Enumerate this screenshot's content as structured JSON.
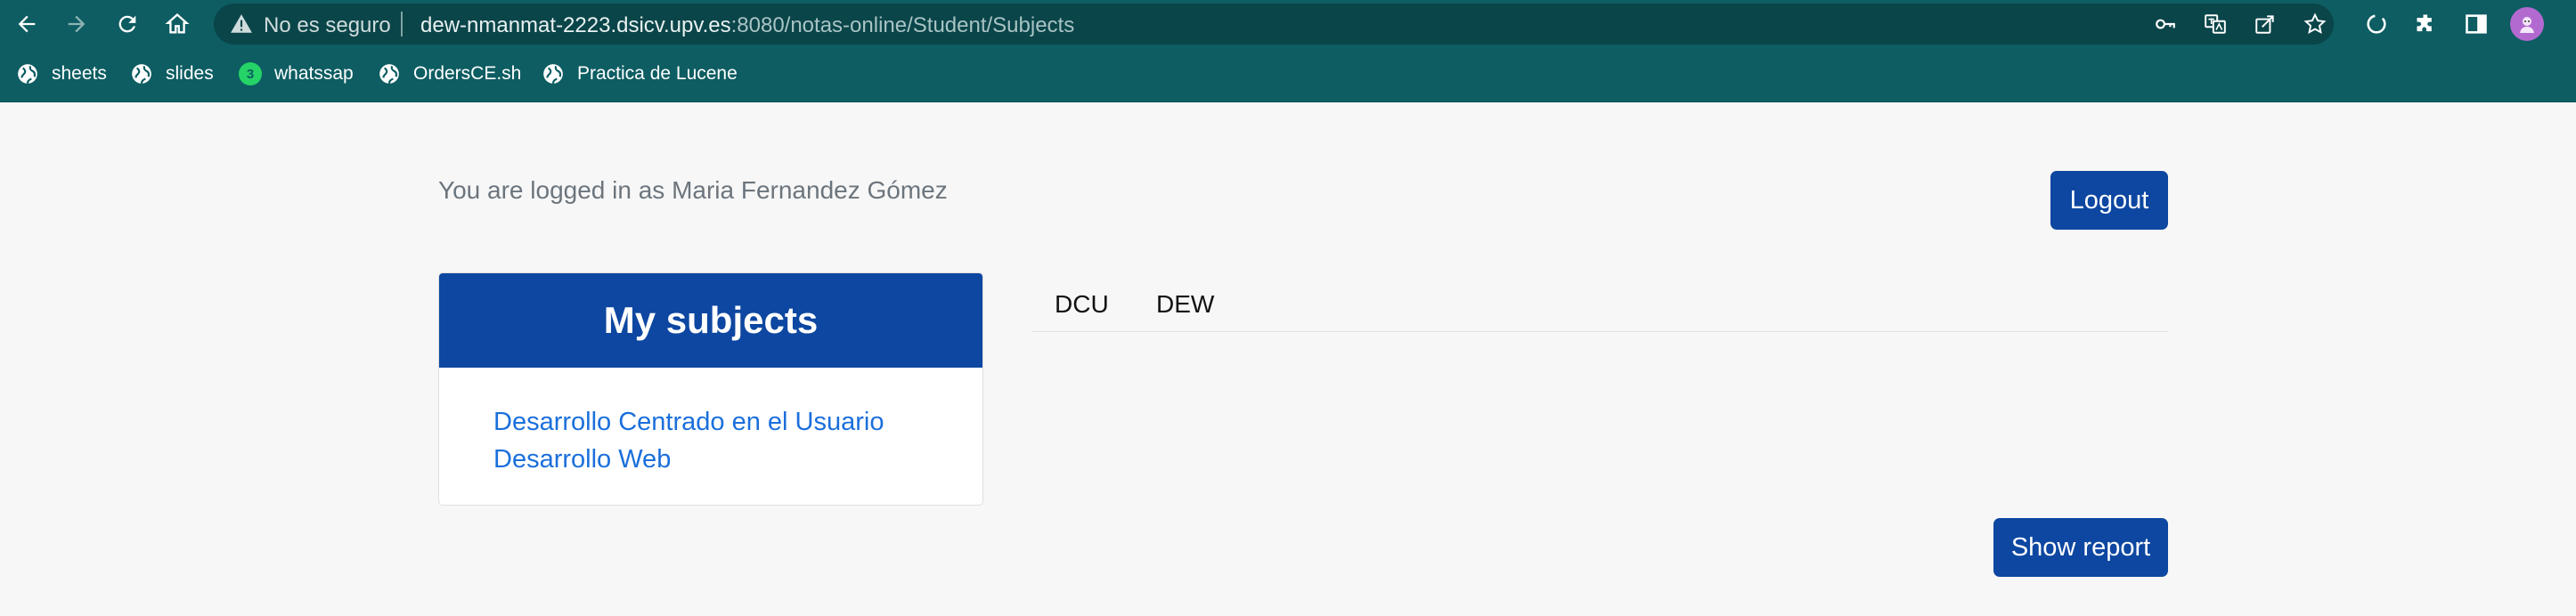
{
  "browser": {
    "security_label": "No es seguro",
    "url_host": "dew-nmanmat-2223.dsicv.upv.es",
    "url_rest": ":8080/notas-online/Student/Subjects",
    "nav_icons": [
      "back-arrow-icon",
      "forward-arrow-icon",
      "reload-icon",
      "home-icon"
    ],
    "omnibox_icons": [
      "key-icon",
      "translate-icon",
      "share-icon",
      "star-icon"
    ],
    "toolbar_icons": [
      "sync-icon",
      "puzzle-extension-icon",
      "side-panel-icon",
      "profile-avatar-icon"
    ],
    "colors": {
      "chrome": "#0d5d62",
      "omnibox": "#0a4549"
    }
  },
  "bookmarks": [
    {
      "label": "sheets",
      "icon": "globe-icon"
    },
    {
      "label": "slides",
      "icon": "globe-icon"
    },
    {
      "label": "whatssap",
      "icon": "whatsapp-icon",
      "badge": "3"
    },
    {
      "label": "OrdersCE.sh",
      "icon": "globe-icon"
    },
    {
      "label": "Practica de Lucene",
      "icon": "globe-icon"
    }
  ],
  "page": {
    "login_text": "You are logged in as Maria Fernandez Gómez",
    "logout_label": "Logout",
    "subjects_card": {
      "title": "My subjects",
      "items": [
        "Desarrollo Centrado en el Usuario",
        "Desarrollo Web"
      ]
    },
    "tabs": [
      "DCU",
      "DEW"
    ],
    "show_report_label": "Show report",
    "colors": {
      "primary": "#0d47a1",
      "link": "#1a6fdb",
      "background": "#f7f7f7"
    }
  }
}
